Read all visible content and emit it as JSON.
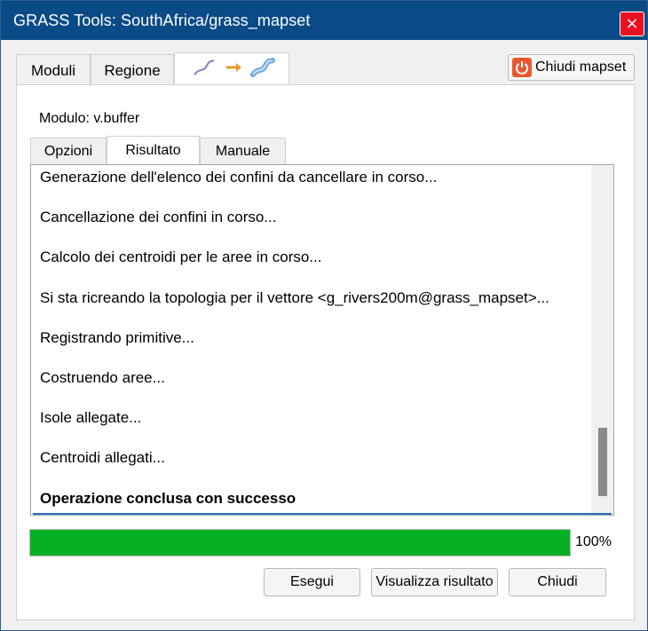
{
  "window": {
    "title": "GRASS Tools: SouthAfrica/grass_mapset",
    "close_glyph": "×",
    "accent_color": "#0a4a86"
  },
  "top_tabs": [
    {
      "label": "Moduli",
      "active": false
    },
    {
      "label": "Regione",
      "active": false
    },
    {
      "label": "",
      "icon": "rivers-to-buffer-icon",
      "active": true
    }
  ],
  "header_buttons": {
    "close_mapset": {
      "label": "Chiudi mapset",
      "icon": "power-icon"
    }
  },
  "module": {
    "label": "Modulo: v.buffer"
  },
  "sub_tabs": [
    {
      "label": "Opzioni",
      "active": false
    },
    {
      "label": "Risultato",
      "active": true
    },
    {
      "label": "Manuale",
      "active": false
    }
  ],
  "output": {
    "lines": [
      {
        "text": "Generazione dell'elenco dei confini da cancellare in corso...",
        "bold": false
      },
      {
        "text": "Cancellazione dei confini in corso...",
        "bold": false
      },
      {
        "text": "Calcolo dei centroidi per le aree in corso...",
        "bold": false
      },
      {
        "text": "Si sta ricreando la topologia per il vettore <g_rivers200m@grass_mapset>...",
        "bold": false
      },
      {
        "text": "Registrando primitive...",
        "bold": false
      },
      {
        "text": "Costruendo aree...",
        "bold": false
      },
      {
        "text": "Isole allegate...",
        "bold": false
      },
      {
        "text": "Centroidi allegati...",
        "bold": false
      },
      {
        "text": "Operazione conclusa con successo",
        "bold": true
      }
    ],
    "scroll_position": 0.95,
    "scroll_visible_fraction": 0.2
  },
  "progress": {
    "value": 1.0,
    "text": "100%",
    "color": "#06b025"
  },
  "buttons": {
    "run": "Esegui",
    "view_result": "Visualizza risultato",
    "close": "Chiudi"
  }
}
